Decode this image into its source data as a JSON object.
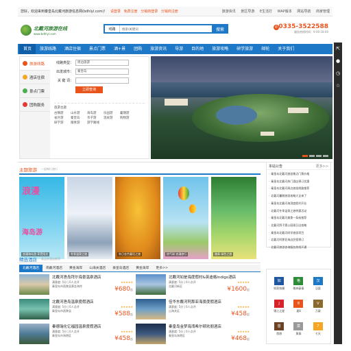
{
  "topbar": {
    "welcome": "您好，欢迎来到秦皇岛北戴河旅游信息网(bdhlyl.com)！",
    "login": "请登录",
    "register": "免费注册",
    "partner_login": "分销商登录",
    "partner_reg": "分销商注册",
    "links": [
      "旅游资讯",
      "景区导游",
      "E生活打",
      "WAP版本",
      "网站导航",
      "商家管理"
    ]
  },
  "header": {
    "logo_text": "北戴河旅游在线",
    "logo_url": "www.bdhlyl.com",
    "search_type": "线路",
    "search_placeholder": "搜索/关键词",
    "search_button": "搜索",
    "phone": "0335-3522588",
    "hours": "服务热线时间：9:00-18:00"
  },
  "nav": [
    "首页",
    "旅游线路",
    "酒店住宿",
    "景点门票",
    "酒+景",
    "团购",
    "旅游资讯",
    "导游",
    "目的地",
    "旅游攻略",
    "研学旅游",
    "邮轮",
    "关于我们"
  ],
  "sidebox": {
    "tabs": [
      "旅游线路",
      "酒店住宿",
      "景点门票",
      "团购服务"
    ],
    "type_label": "线路类型：",
    "type_value": "周边旅游",
    "city_label": "出发城市：",
    "city_value": "秦皇岛",
    "kw_label": "关 键 词：",
    "button": "立即查询",
    "hot_label": "旅游主题",
    "hot": [
      "古镇游",
      "山水游",
      "海岛游",
      "乐园游",
      "暑期游",
      "省外游",
      "秦皇岛",
      "亲子游",
      "温泉游",
      "购物游",
      "研学游",
      "踏青游",
      "游学路线"
    ]
  },
  "tours": {
    "title": "主题旅游",
    "sub": "一起畅行旅行",
    "items": [
      {
        "cap": "浪漫海岛游 享受阳光"
      },
      {
        "cap": "冬季温泉之旅"
      },
      {
        "cap": "秋日金色童话之旅"
      },
      {
        "cap": "热气球 浪漫旅行"
      },
      {
        "cap": "踏青 绿色之旅"
      }
    ],
    "banner_text": [
      "浪漫",
      "海岛游"
    ]
  },
  "notice": {
    "title": "本站公告",
    "more": "更多>>",
    "items": [
      "秦皇岛北戴河旅游景点门票价格",
      "秦皇岛北戴河热门酒店预订优惠",
      "秦皇岛北戴河周边旅游线路推荐",
      "北戴河暑期旅游攻略大全来了",
      "秦皇岛北戴河海滨度假村开业",
      "北戴河冬季温泉之旅特惠活动",
      "秦皇岛北戴河美食一条街推荐",
      "北戴河鸽子窝公园观日出攻略",
      "秦皇岛北戴河研学旅游项目",
      "北戴河阿那亚海边民宿预订",
      "北戴河旅游咨询服务热线开通"
    ]
  },
  "hotels": {
    "title": "精选酒店",
    "sub": "高品质酒店推荐",
    "tabs": [
      "北戴河酒店",
      "南戴河酒店",
      "黄金海岸",
      "山海关酒店",
      "秦皇岛酒店",
      "黄金海岸",
      "更多>>"
    ],
    "items": [
      {
        "name": "北戴河渔岛拜尔海景温泉酒店",
        "meta": "满意度: 5分 | 0人点评",
        "addr": "秦皇岛市昌黎县黄金海岸",
        "stars": "★★★★★",
        "price": "¥680",
        "from": "起"
      },
      {
        "name": "北戴河如是海度假村&英迪格Indigo酒店",
        "meta": "满意度: 5分 | 0人点评",
        "addr": "北戴河新区",
        "stars": "★★★★★",
        "price": "¥1600",
        "from": "起"
      },
      {
        "name": "北戴河渔岛温泉度假酒店",
        "meta": "满意度: 5分 | 0人点评",
        "addr": "秦皇岛市昌黎县",
        "stars": "★★★★★",
        "price": "¥588",
        "from": "起"
      },
      {
        "name": "佳华东戴河阿那亚海景度假酒店",
        "meta": "满意度: 5分 | 0人点评",
        "addr": "山海关区",
        "stars": "★★★★★",
        "price": "¥458",
        "from": "起"
      },
      {
        "name": "秦德瑞化亿福园温泉度假酒店",
        "meta": "满意度: 5分 | 0人点评",
        "addr": "秦皇岛市海港区",
        "stars": "★★★★★",
        "price": "¥458",
        "from": "起"
      },
      {
        "name": "秦皇岛金梦海湾希尔顿欢朋酒店",
        "meta": "满意度: 5分 | 0人点评",
        "addr": "秦皇岛海港区",
        "stars": "★★★★★",
        "price": "¥468",
        "from": "起"
      }
    ]
  },
  "brands": [
    {
      "name": "如家快捷",
      "c": "#1e56a0",
      "t": "如"
    },
    {
      "name": "格林豪泰",
      "c": "#2e8b3a",
      "t": "格"
    },
    {
      "name": "汉庭",
      "c": "#1e78c8",
      "t": "汉"
    },
    {
      "name": "锦江之星",
      "c": "#d6242a",
      "t": "J"
    },
    {
      "name": "速8",
      "c": "#e8541c",
      "t": "8"
    },
    {
      "name": "万豪",
      "c": "#8b6a2e",
      "t": "V"
    },
    {
      "name": "首旅",
      "c": "#6b4226",
      "t": "首"
    },
    {
      "name": "莫泰",
      "c": "#999999",
      "t": "莫"
    },
    {
      "name": "七天",
      "c": "#f5a623",
      "t": "7"
    }
  ]
}
